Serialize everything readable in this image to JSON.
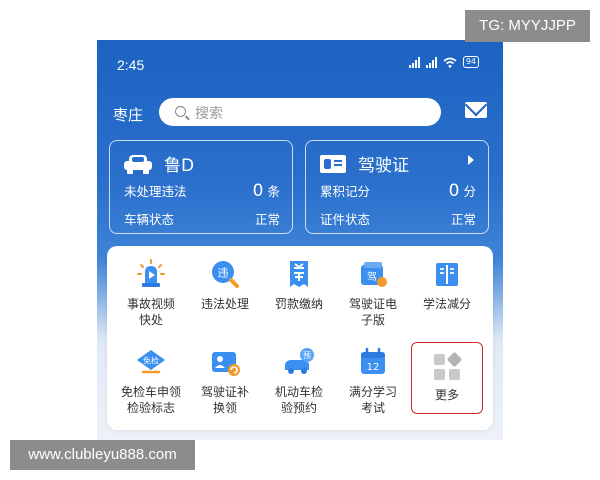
{
  "watermarks": {
    "tg": "TG: MYYJJPP",
    "url": "www.clubleyu888.com"
  },
  "status_bar": {
    "time": "2:45",
    "battery": "94"
  },
  "header": {
    "city": "枣庄",
    "search_placeholder": "搜索",
    "icon_mail": "mail-icon"
  },
  "vehicle_card": {
    "plate": "鲁D",
    "row1_label": "未处理违法",
    "row1_value": "0",
    "row1_unit": "条",
    "row2_label": "车辆状态",
    "row2_value": "正常"
  },
  "license_card": {
    "title": "驾驶证",
    "row1_label": "累积记分",
    "row1_value": "0",
    "row1_unit": "分",
    "row2_label": "证件状态",
    "row2_value": "正常"
  },
  "services": [
    {
      "label": "事故视频快处",
      "icon": "accident-video-icon"
    },
    {
      "label": "违法处理",
      "icon": "violation-icon",
      "glyph": "违"
    },
    {
      "label": "罚款缴纳",
      "icon": "fine-payment-icon"
    },
    {
      "label": "驾驶证电子版",
      "icon": "e-license-icon",
      "glyph": "驾"
    },
    {
      "label": "学法减分",
      "icon": "study-book-icon"
    },
    {
      "label": "免检车申领检验标志",
      "icon": "exempt-inspection-icon",
      "glyph": "免检"
    },
    {
      "label": "驾驶证补换领",
      "icon": "license-renew-icon"
    },
    {
      "label": "机动车检验预约",
      "icon": "inspection-booking-icon",
      "glyph": "预"
    },
    {
      "label": "满分学习考试",
      "icon": "calendar-exam-icon",
      "glyph": "12"
    },
    {
      "label": "更多",
      "icon": "more-grid-icon"
    }
  ],
  "colors": {
    "primary": "#2a6fcb",
    "icon_orange": "#f39a2b",
    "highlight_border": "#cc2e2e"
  }
}
